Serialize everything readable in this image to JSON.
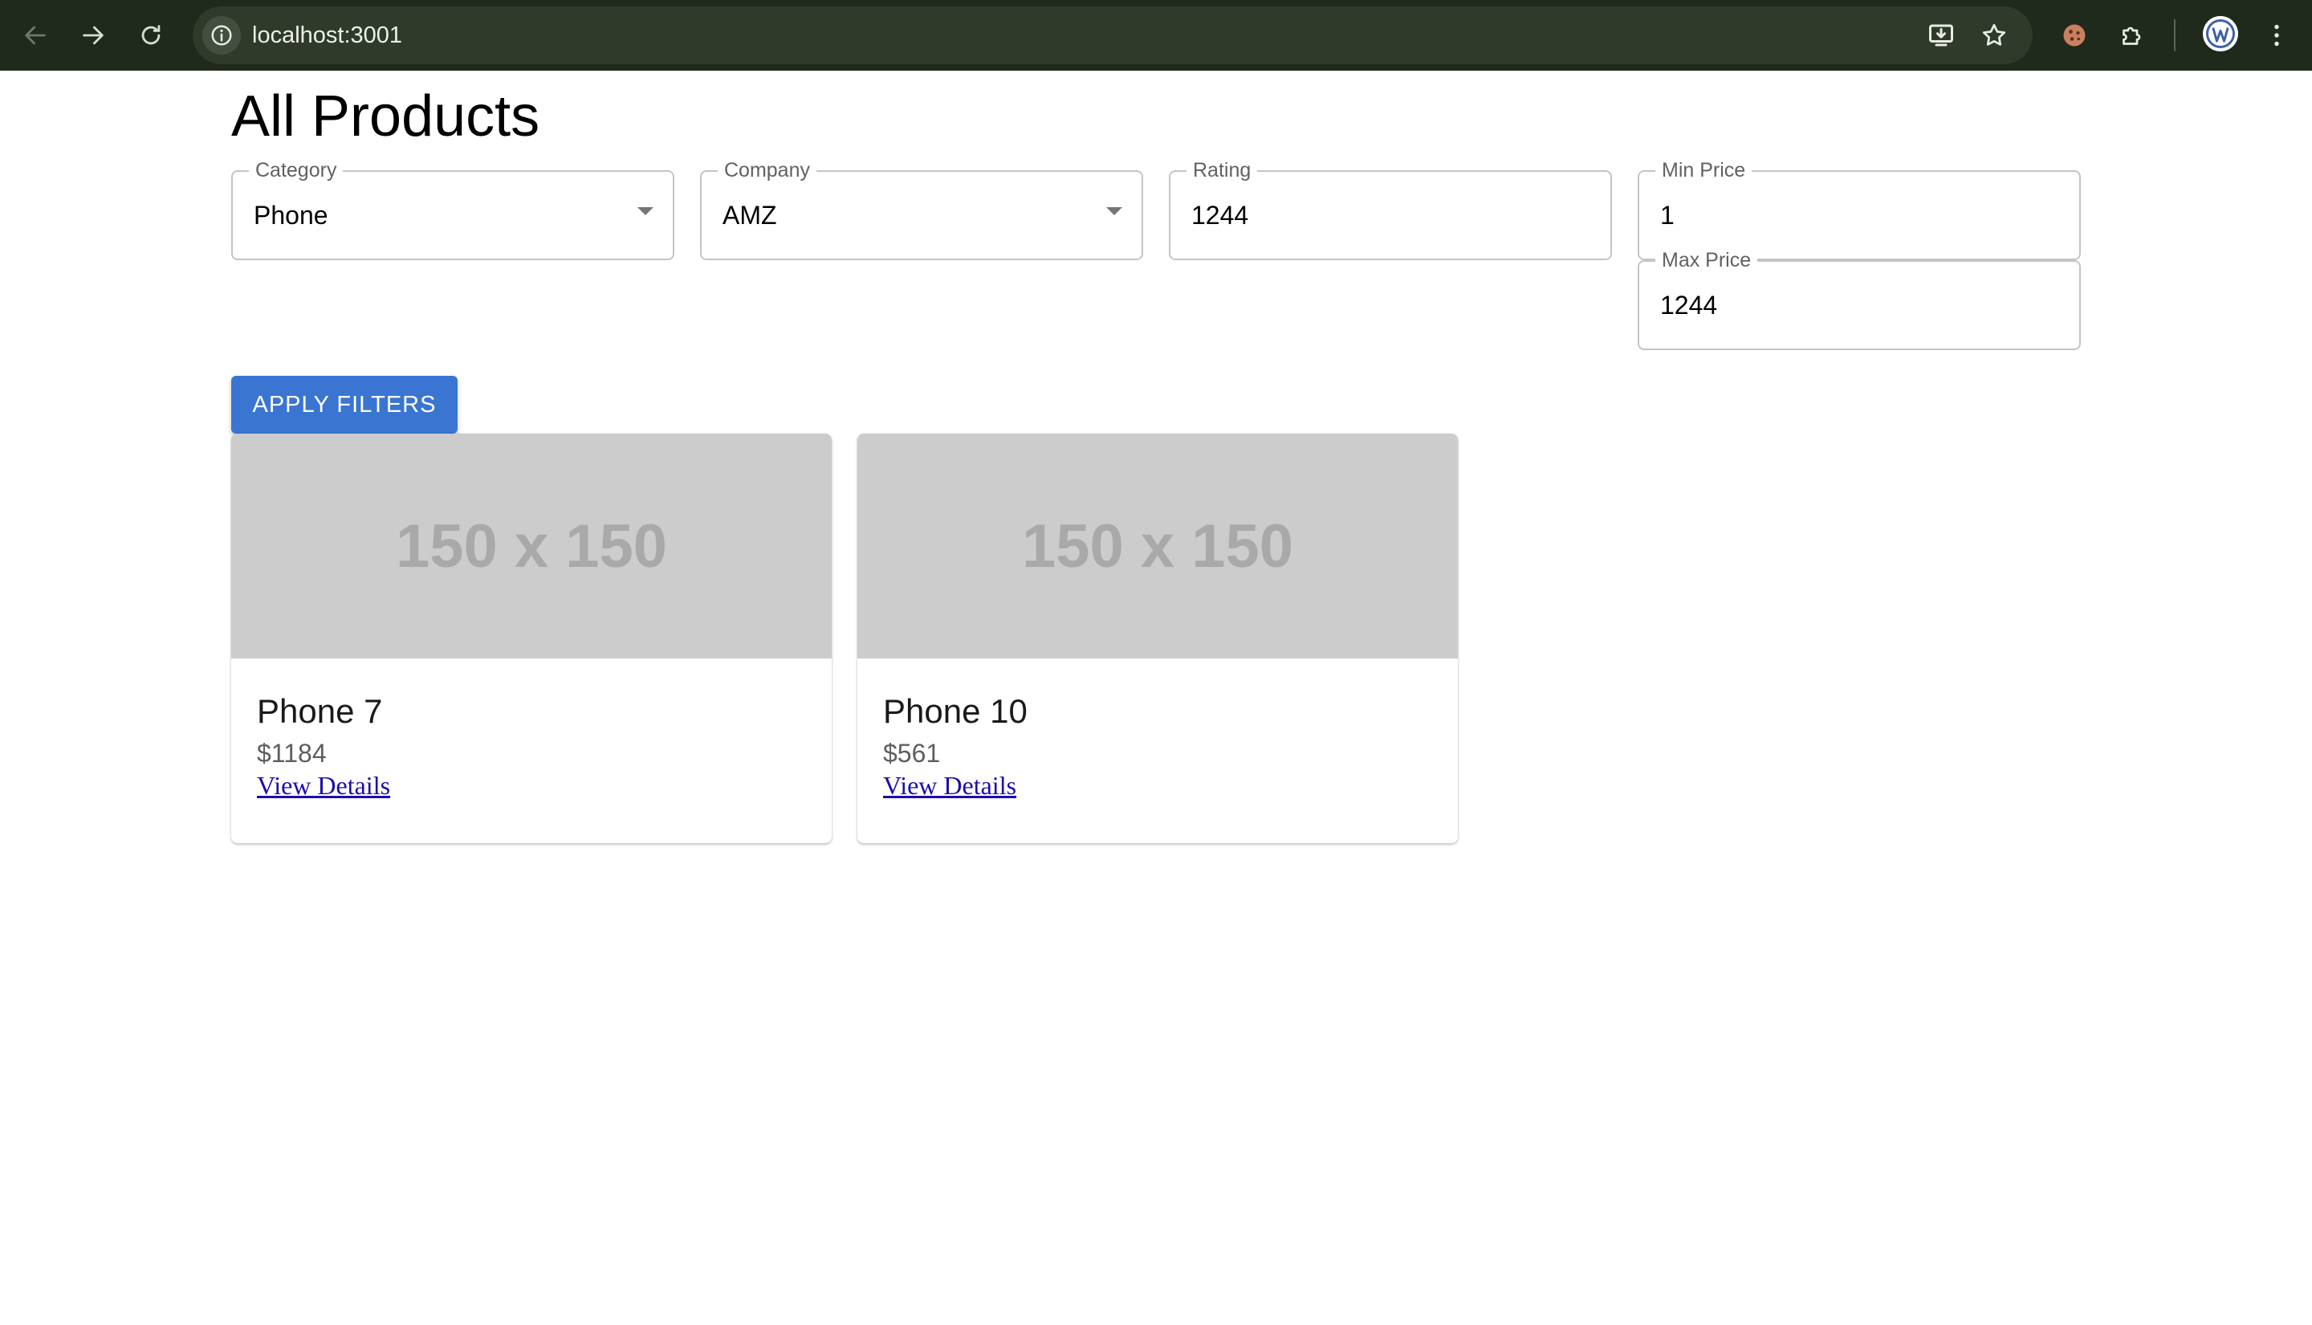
{
  "browser": {
    "url": "localhost:3001",
    "icons": {
      "back": "arrow-left-icon",
      "forward": "arrow-right-icon",
      "reload": "reload-icon",
      "site_info": "info-icon",
      "install": "install-app-icon",
      "bookmark": "star-icon",
      "cookie": "cookie-icon",
      "extensions": "puzzle-icon",
      "menu": "more-vertical-icon"
    },
    "theme_color": "#1f291c"
  },
  "page": {
    "title": "All Products"
  },
  "filters": {
    "category": {
      "label": "Category",
      "value": "Phone"
    },
    "company": {
      "label": "Company",
      "value": "AMZ"
    },
    "rating": {
      "label": "Rating",
      "value": "1244"
    },
    "min_price": {
      "label": "Min Price",
      "value": "1"
    },
    "max_price": {
      "label": "Max Price",
      "value": "1244"
    },
    "apply_label": "APPLY FILTERS",
    "apply_color": "#3a75d2"
  },
  "products": [
    {
      "image_text": "150 x 150",
      "name": "Phone 7",
      "price": "$1184",
      "link_label": "View Details"
    },
    {
      "image_text": "150 x 150",
      "name": "Phone 10",
      "price": "$561",
      "link_label": "View Details"
    }
  ]
}
